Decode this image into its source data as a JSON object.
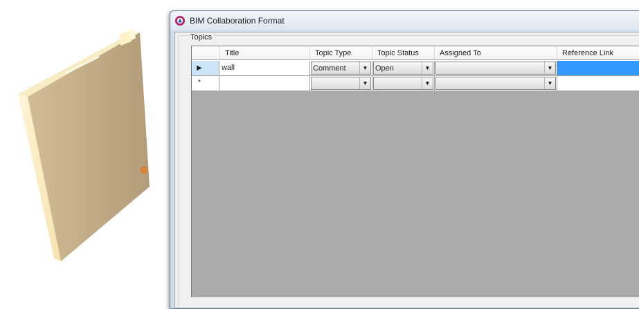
{
  "window": {
    "title": "BIM Collaboration Format",
    "icon": "bcf-logo-icon"
  },
  "group": {
    "label": "Topics"
  },
  "grid": {
    "columns": [
      "Title",
      "Topic Type",
      "Topic Status",
      "Assigned To",
      "Reference Link"
    ],
    "rows": [
      {
        "marker": "▶",
        "title": "wall",
        "topic_type": "Comment",
        "topic_status": "Open",
        "assigned_to": "",
        "reference_link": ""
      },
      {
        "marker": "*",
        "title": "",
        "topic_type": "",
        "topic_status": "",
        "assigned_to": "",
        "reference_link": ""
      }
    ]
  },
  "colors": {
    "selection": "#3399ff",
    "empty_area": "#ababab",
    "wall_face": "#c2ab88",
    "wall_edge": "#fff1c2"
  }
}
